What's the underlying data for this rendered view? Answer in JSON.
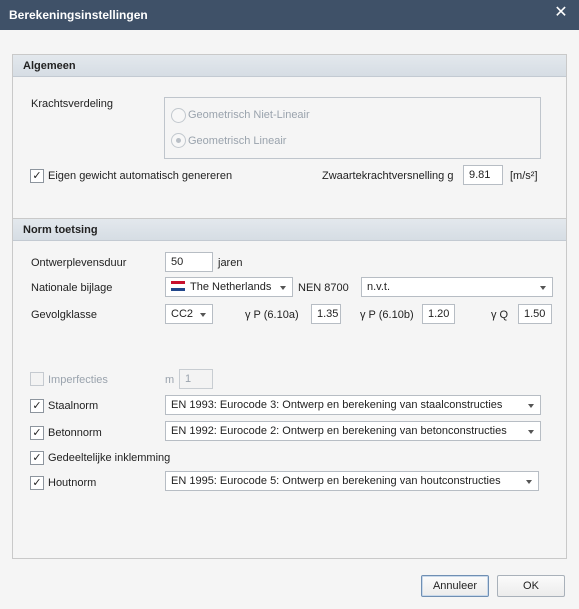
{
  "dialog": {
    "title": "Berekeningsinstellingen"
  },
  "algemeen": {
    "header": "Algemeen",
    "krachtsverdeling_label": "Krachtsverdeling",
    "options": [
      "Geometrisch Niet-Lineair",
      "Geometrisch Lineair"
    ],
    "selected_option": "Geometrisch Lineair",
    "eigen_gewicht_label": "Eigen gewicht automatisch genereren",
    "eigen_gewicht_checked": true,
    "zwaartekracht_label": "Zwaartekrachtversnelling g",
    "zwaartekracht_value": "9.81",
    "zwaartekracht_unit": "[m/s²]"
  },
  "norm": {
    "header": "Norm toetsing",
    "ontwerplevensduur_label": "Ontwerplevensduur",
    "ontwerplevensduur_value": "50",
    "ontwerplevensduur_unit": "jaren",
    "nationale_bijlage_label": "Nationale bijlage",
    "nationale_bijlage_value": "The Netherlands",
    "nen_label": "NEN 8700",
    "nen_value": "n.v.t.",
    "gevolgklasse_label": "Gevolgklasse",
    "gevolgklasse_value": "CC2",
    "gamma_p_a_label": "γ P (6.10a)",
    "gamma_p_a_value": "1.35",
    "gamma_p_b_label": "γ P (6.10b)",
    "gamma_p_b_value": "1.20",
    "gamma_q_label": "γ Q",
    "gamma_q_value": "1.50",
    "imperfecties_label": "Imperfecties",
    "imperfecties_m_label": "m",
    "imperfecties_m_value": "1",
    "staalnorm_label": "Staalnorm",
    "staalnorm_value": "EN 1993: Eurocode 3: Ontwerp en berekening van staalconstructies",
    "betonnorm_label": "Betonnorm",
    "betonnorm_value": "EN 1992: Eurocode 2: Ontwerp en berekening van betonconstructies",
    "inklemming_label": "Gedeeltelijke inklemming",
    "houtnorm_label": "Houtnorm",
    "houtnorm_value": "EN 1995: Eurocode 5: Ontwerp en berekening van houtconstructies"
  },
  "buttons": {
    "cancel": "Annuleer",
    "ok": "OK"
  },
  "colors": {
    "titlebar": "#3f5168",
    "group_header": "#dde3e9",
    "flag_red": "#c8102e",
    "flag_white": "#ffffff",
    "flag_blue": "#21468b"
  }
}
